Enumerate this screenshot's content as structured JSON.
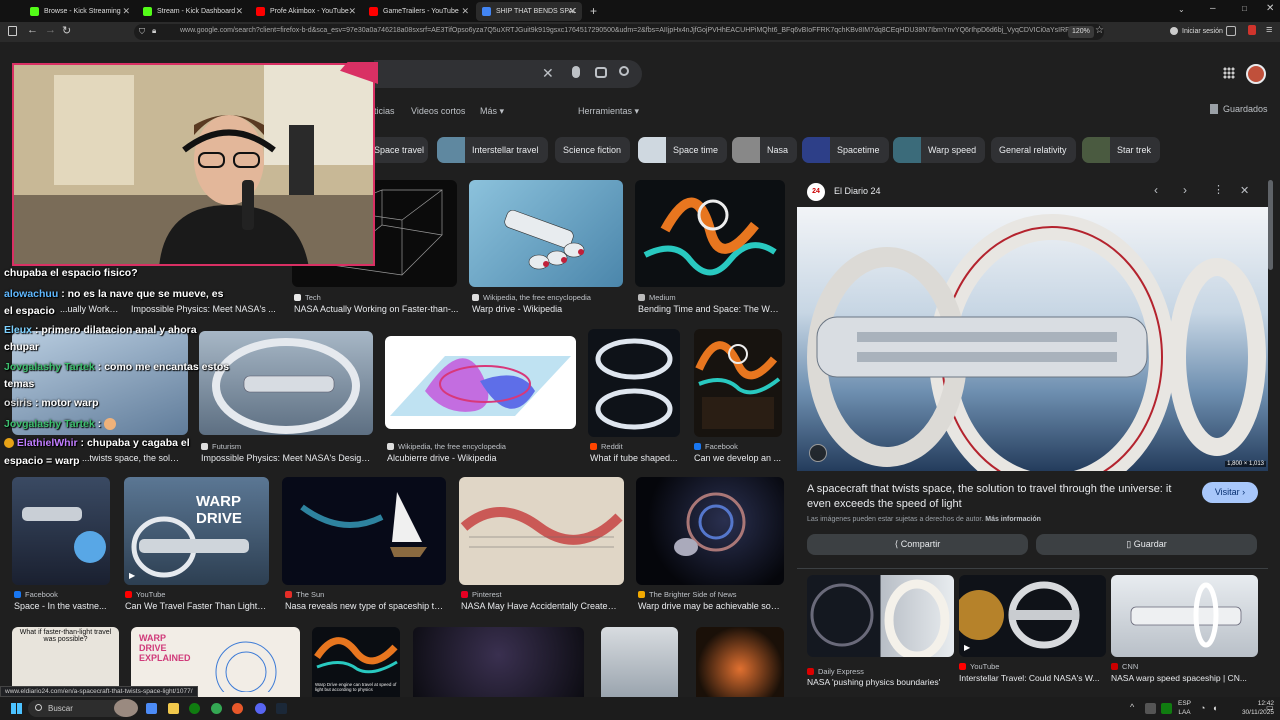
{
  "browser": {
    "tabs": [
      {
        "title": "Browse - Kick Streaming",
        "color": "#53fc18"
      },
      {
        "title": "Stream - Kick Dashboard",
        "color": "#53fc18"
      },
      {
        "title": "Profe Akimbox - YouTube",
        "color": "#ff0000"
      },
      {
        "title": "GameTrailers - YouTube",
        "color": "#ff0000"
      },
      {
        "title": "SHIP THAT BENDS SPACE - Busc",
        "color": "#4285f4"
      }
    ],
    "url": "www.google.com/search?client=firefox-b-d&sca_esv=97e30a0a746218a08sxsrf=AE3TifOpso6yza7Q5uXRTJGuit9k919gsxc1764517290500&udm=2&fbs=AIIjpHx4nJjfGojPVHhEACUHPiMQht6_BFq6vBIoFFRK7qchKBv8IM7dq8CEqHDU38N7IbmYnvYQ6rIhpD6d6bj_VyqCDVICi0aYsIRFVg6",
    "zoom": "120%",
    "sign_in": "Iniciar sesión"
  },
  "search": {
    "nav": [
      "ticias",
      "Videos cortos",
      "Más",
      "Herramientas"
    ],
    "saved": "Guardados",
    "chips": [
      {
        "label": "Space travel",
        "thumb": false
      },
      {
        "label": "Interstellar travel",
        "thumb": true,
        "color": "#5f88a0"
      },
      {
        "label": "Science fiction",
        "thumb": false
      },
      {
        "label": "Space time",
        "thumb": true,
        "color": "#cfd8e0"
      },
      {
        "label": "Nasa",
        "thumb": true,
        "color": "#888"
      },
      {
        "label": "Spacetime",
        "thumb": true,
        "color": "#2d3f88"
      },
      {
        "label": "Warp speed",
        "thumb": true,
        "color": "#3b6b7a"
      },
      {
        "label": "General relativity",
        "thumb": false
      },
      {
        "label": "Star trek",
        "thumb": true,
        "color": "#4a5a40"
      }
    ],
    "results": [
      {
        "source": "",
        "caption": "...ually Working...",
        "color": "#2a3f5a"
      },
      {
        "source": "",
        "caption": "Impossible Physics: Meet NASA's ...",
        "color": "#3b4a66"
      },
      {
        "source": "Tech",
        "caption": "NASA Actually Working on Faster-than-...",
        "color": "#111"
      },
      {
        "source": "Wikipedia, the free encyclopedia",
        "caption": "Warp drive - Wikipedia",
        "color": "#6fa9c8"
      },
      {
        "source": "Medium",
        "caption": "Bending Time and Space: The War...",
        "color": "#0f1216"
      },
      {
        "source": "",
        "caption": "...twists space, the solutio...",
        "color": "#8fa7bd"
      },
      {
        "source": "Futurism",
        "caption": "Impossible Physics: Meet NASA's Design ...",
        "color": "#8ea0b2"
      },
      {
        "source": "Wikipedia, the free encyclopedia",
        "caption": "Alcubierre drive - Wikipedia",
        "color": "#e8eef5"
      },
      {
        "source": "Reddit",
        "caption": "What if tube shaped...",
        "color": "#0e1218"
      },
      {
        "source": "Facebook",
        "caption": "Can we develop an ...",
        "color": "#181410"
      },
      {
        "source": "Facebook",
        "caption": "Space - In the vastne...",
        "color": "#2b3648"
      },
      {
        "source": "YouTube",
        "caption": "Can We Travel Faster Than Light? ...",
        "color": "#4f6a86"
      },
      {
        "source": "The Sun",
        "caption": "Nasa reveals new type of spaceship th...",
        "color": "#0c1020"
      },
      {
        "source": "Pinterest",
        "caption": "NASA May Have Accidentally Created ...",
        "color": "#d9cfc0"
      },
      {
        "source": "The Brighter Side of News",
        "caption": "Warp drive may be achievable soo...",
        "color": "#101018"
      },
      {
        "source": "",
        "caption": "What if faster-than-light travel was possible?",
        "color": "#e8e4dc"
      },
      {
        "source": "",
        "caption": "WARP DRIVE EXPLAINED",
        "color": "#f2ede6"
      },
      {
        "source": "",
        "caption": "Warp Drive engine can travel at speed of light but according to physics",
        "color": "#0a0d12"
      },
      {
        "source": "",
        "caption": "",
        "color": "#101014"
      },
      {
        "source": "",
        "caption": "",
        "color": "#d0d4d8"
      },
      {
        "source": "",
        "caption": "",
        "color": "#1a1008"
      }
    ],
    "warp_drive_title": "WARP DRIVE"
  },
  "panel": {
    "site": "El Diario 24",
    "title": "A spacecraft that twists space, the solution to travel through the universe: it even exceeds the speed of light",
    "visit": "Visitar",
    "dims": "1,800 × 1,013",
    "notice": "Las imágenes pueden estar sujetas a derechos de autor.",
    "more_info": "Más información",
    "share": "Compartir",
    "save": "Guardar",
    "related": [
      {
        "source": "Daily Express",
        "caption": "NASA 'pushing physics boundaries'",
        "color": "#b8bec6"
      },
      {
        "source": "YouTube",
        "caption": "Interstellar Travel: Could NASA's W...",
        "color": "#0f1218"
      },
      {
        "source": "CNN",
        "caption": "NASA warp speed spaceship | CN...",
        "color": "#d4d8de"
      }
    ]
  },
  "chat": [
    {
      "user": "",
      "text": "chupaba el espacio fisico?",
      "ucolor": "#fff"
    },
    {
      "user": "alowachuu",
      "text": ": no es la nave que se mueve, es",
      "ucolor": "#5fb8ff"
    },
    {
      "user": "",
      "text": "el espacio",
      "ucolor": "#fff"
    },
    {
      "user": "Eleux",
      "text": ": primero dilatacion anal y ahora",
      "ucolor": "#7fd2ff"
    },
    {
      "user": "",
      "text": "chupar",
      "ucolor": "#fff"
    },
    {
      "user": "Jovgalashy Tartek",
      "text": ": como me encantas estos",
      "ucolor": "#3dbf6e"
    },
    {
      "user": "",
      "text": "temas",
      "ucolor": "#fff"
    },
    {
      "user": "osiris",
      "text": ": motor warp",
      "ucolor": "#ddd"
    },
    {
      "user": "Jovgalashy Tartek",
      "text": ":",
      "ucolor": "#3dbf6e"
    },
    {
      "user": "ElathielWhir",
      "text": ": chupaba y cagaba el",
      "ucolor": "#c07dff"
    },
    {
      "user": "",
      "text": "espacio = warp",
      "ucolor": "#fff"
    }
  ],
  "status_url": "www.eldiario24.com/en/a-spacecraft-that-twists-space-light/1077/",
  "taskbar": {
    "search": "Buscar",
    "lang": "ESP",
    "lang2": "LAA",
    "time": "12:42",
    "date": "30/11/2025"
  }
}
